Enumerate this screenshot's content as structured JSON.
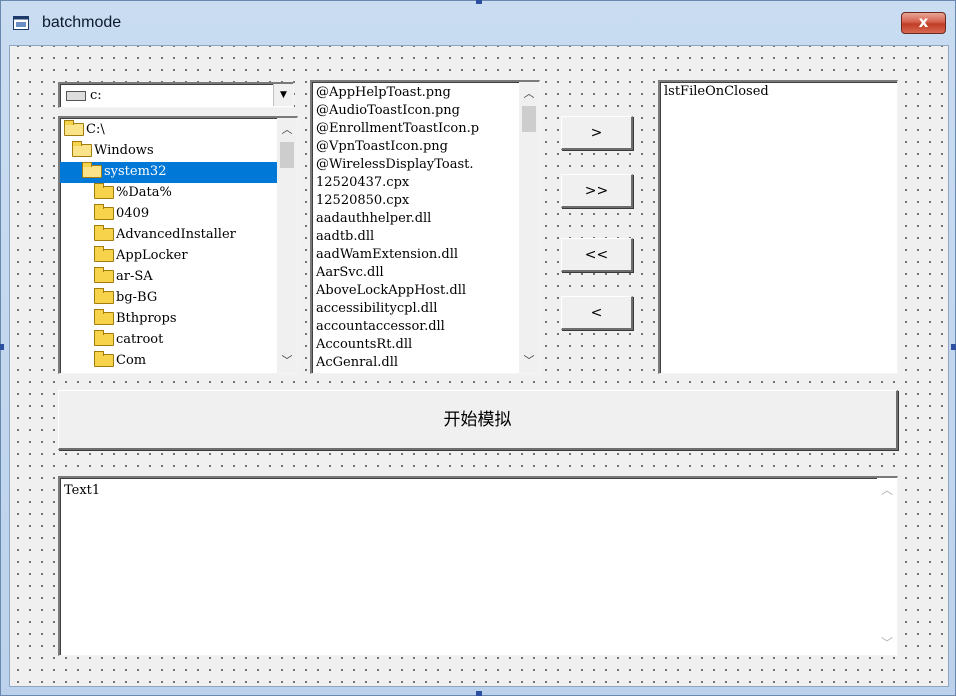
{
  "window": {
    "title": "batchmode",
    "close_label": "x"
  },
  "drive": {
    "value": "c:",
    "icon": "drive-icon",
    "dropdown_icon": "chevron-down-icon"
  },
  "dir_list": {
    "items": [
      {
        "label": "C:\\",
        "icon": "folder-open-icon"
      },
      {
        "label": "Windows",
        "icon": "folder-open-icon"
      },
      {
        "label": "system32",
        "icon": "folder-open-icon",
        "selected": true
      },
      {
        "label": "%Data%",
        "icon": "folder-icon"
      },
      {
        "label": "0409",
        "icon": "folder-icon"
      },
      {
        "label": "AdvancedInstaller",
        "icon": "folder-icon"
      },
      {
        "label": "AppLocker",
        "icon": "folder-icon"
      },
      {
        "label": "ar-SA",
        "icon": "folder-icon"
      },
      {
        "label": "bg-BG",
        "icon": "folder-icon"
      },
      {
        "label": "Bthprops",
        "icon": "folder-icon"
      },
      {
        "label": "catroot",
        "icon": "folder-icon"
      },
      {
        "label": "Com",
        "icon": "folder-icon"
      }
    ]
  },
  "file_list": {
    "items": [
      "@AppHelpToast.png",
      "@AudioToastIcon.png",
      "@EnrollmentToastIcon.p",
      "@VpnToastIcon.png",
      "@WirelessDisplayToast.",
      "12520437.cpx",
      "12520850.cpx",
      "aadauthhelper.dll",
      "aadtb.dll",
      "aadWamExtension.dll",
      "AarSvc.dll",
      "AboveLockAppHost.dll",
      "accessibilitycpl.dll",
      "accountaccessor.dll",
      "AccountsRt.dll",
      "AcGenral.dll"
    ]
  },
  "buttons": {
    "add_one": ">",
    "add_all": ">>",
    "remove_all": "<<",
    "remove_one": "<"
  },
  "right_list": {
    "items": [
      "lstFileOnClosed"
    ]
  },
  "start_button": "开始模拟",
  "textbox": {
    "value": "Text1"
  }
}
